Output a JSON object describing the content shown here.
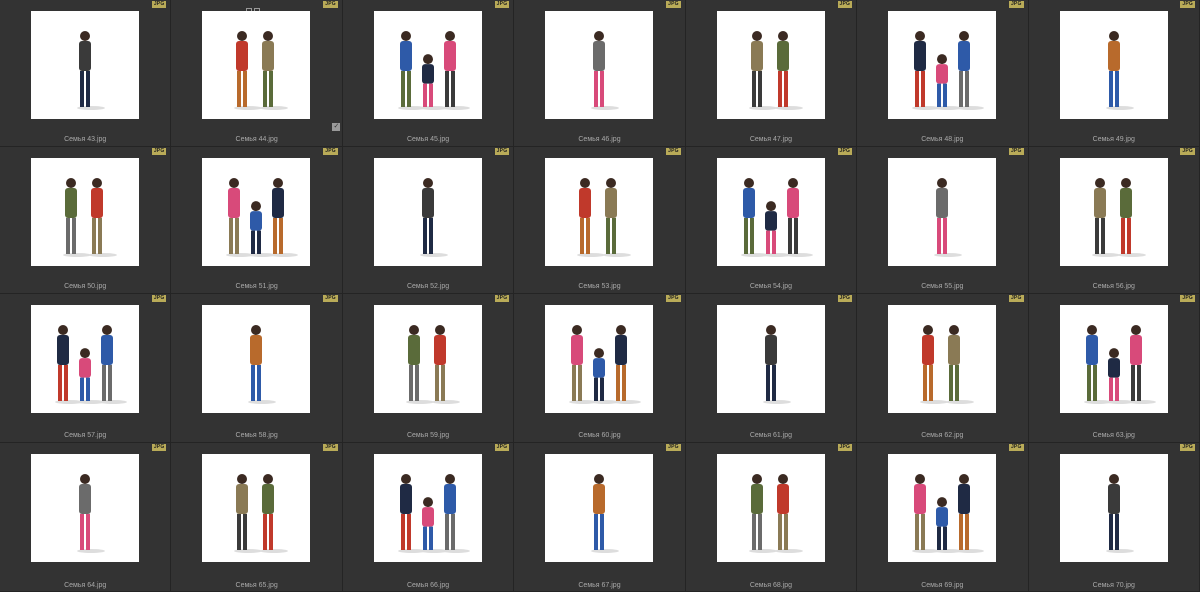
{
  "badge_text": "JPG",
  "colors": {
    "background": "#2a2a2a",
    "cell": "#333333",
    "badge": "#b9ab58",
    "caption": "#a9a9a9"
  },
  "selection_icons": [
    "checkbox-icon",
    "edit-icon"
  ],
  "tiles": [
    {
      "caption": "Семья 43.jpg"
    },
    {
      "caption": "Семья 44.jpg",
      "selected": true
    },
    {
      "caption": "Семья 45.jpg"
    },
    {
      "caption": "Семья 46.jpg"
    },
    {
      "caption": "Семья 47.jpg"
    },
    {
      "caption": "Семья 48.jpg"
    },
    {
      "caption": "Семья 49.jpg"
    },
    {
      "caption": "Семья 50.jpg"
    },
    {
      "caption": "Семья 51.jpg"
    },
    {
      "caption": "Семья 52.jpg"
    },
    {
      "caption": "Семья 53.jpg"
    },
    {
      "caption": "Семья 54.jpg"
    },
    {
      "caption": "Семья 55.jpg"
    },
    {
      "caption": "Семья 56.jpg"
    },
    {
      "caption": "Семья 57.jpg"
    },
    {
      "caption": "Семья 58.jpg"
    },
    {
      "caption": "Семья 59.jpg"
    },
    {
      "caption": "Семья 60.jpg"
    },
    {
      "caption": "Семья 61.jpg"
    },
    {
      "caption": "Семья 62.jpg"
    },
    {
      "caption": "Семья 63.jpg"
    },
    {
      "caption": "Семья 64.jpg"
    },
    {
      "caption": "Семья 65.jpg"
    },
    {
      "caption": "Семья 66.jpg"
    },
    {
      "caption": "Семья 67.jpg"
    },
    {
      "caption": "Семья 68.jpg"
    },
    {
      "caption": "Семья 69.jpg"
    },
    {
      "caption": "Семья 70.jpg"
    }
  ]
}
